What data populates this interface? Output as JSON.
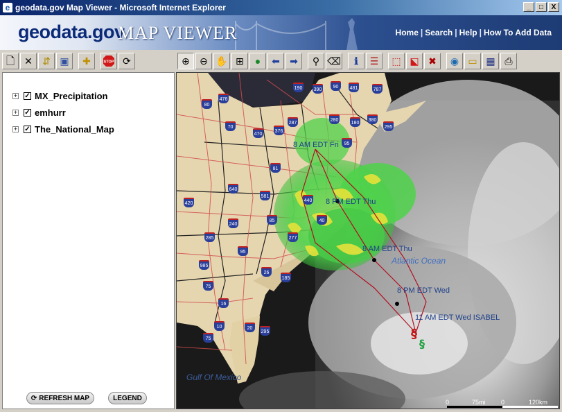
{
  "window": {
    "title": "geodata.gov Map Viewer - Microsoft Internet Explorer",
    "buttons": [
      "_",
      "□",
      "X"
    ]
  },
  "banner": {
    "logo_text": "geodata.gov",
    "app_title": "MAP VIEWER",
    "nav": [
      "Home",
      "Search",
      "Help",
      "How To Add Data"
    ]
  },
  "toolbar_left": [
    {
      "icon": "new-document-icon",
      "glyph": "🗋"
    },
    {
      "icon": "close-x-icon",
      "glyph": "✕"
    },
    {
      "icon": "layer-order-icon",
      "glyph": "⇵"
    },
    {
      "icon": "layer-properties-icon",
      "glyph": "▣"
    },
    {
      "icon": "add-data-icon",
      "glyph": "✚"
    },
    {
      "icon": "stop-icon",
      "glyph": "STOP"
    },
    {
      "icon": "refresh-icon",
      "glyph": "⟳"
    }
  ],
  "toolbar_right": [
    {
      "icon": "zoom-in-icon",
      "glyph": "⊕",
      "active": true
    },
    {
      "icon": "zoom-out-icon",
      "glyph": "⊖"
    },
    {
      "icon": "pan-hand-icon",
      "glyph": "✋"
    },
    {
      "icon": "zoom-extent-icon",
      "glyph": "⊞"
    },
    {
      "icon": "full-extent-globe-icon",
      "glyph": "🌐"
    },
    {
      "icon": "back-arrow-icon",
      "glyph": "⬅"
    },
    {
      "icon": "forward-arrow-icon",
      "glyph": "➡"
    },
    {
      "icon": "find-binoculars-icon",
      "glyph": "⛯"
    },
    {
      "icon": "clear-trash-icon",
      "glyph": "🗑"
    },
    {
      "icon": "info-icon",
      "glyph": "ℹ"
    },
    {
      "icon": "legend-list-icon",
      "glyph": "☰"
    },
    {
      "icon": "select-rectangle-icon",
      "glyph": "⬚"
    },
    {
      "icon": "select-feature-icon",
      "glyph": "⬕"
    },
    {
      "icon": "clear-selection-icon",
      "glyph": "🗑"
    },
    {
      "icon": "print-globe-icon",
      "glyph": "🌍"
    },
    {
      "icon": "open-folder-icon",
      "glyph": "📂"
    },
    {
      "icon": "save-disk-icon",
      "glyph": "💾"
    },
    {
      "icon": "print-icon",
      "glyph": "🖶"
    }
  ],
  "layers": [
    {
      "name": "MX_Precipitation",
      "checked": true
    },
    {
      "name": "emhurr",
      "checked": true
    },
    {
      "name": "The_National_Map",
      "checked": true
    }
  ],
  "panel_buttons": {
    "refresh": "REFRESH MAP",
    "legend": "LEGEND"
  },
  "map_labels": {
    "track": [
      "8 AM EDT Fri",
      "8 PM EDT Thu",
      "8 AM EDT Thu",
      "8 PM EDT Wed",
      "11 AM EDT Wed ISABEL"
    ],
    "atlantic": "Atlantic Ocean",
    "gulf": "Gulf Of Mexico"
  },
  "highway_shields": [
    "190",
    "390",
    "90",
    "481",
    "787",
    "80",
    "476",
    "280",
    "180",
    "380",
    "295",
    "70",
    "470",
    "376",
    "287",
    "95",
    "81",
    "581",
    "440",
    "40",
    "85",
    "277",
    "26",
    "95",
    "185",
    "75",
    "285",
    "985",
    "20",
    "16",
    "75",
    "295",
    "10",
    "640",
    "240",
    "420"
  ],
  "scale": {
    "labels": [
      "0",
      "75mi",
      "0",
      "120km"
    ]
  },
  "colors": {
    "title_bar": "#0a246a",
    "banner_dark": "#1d3b74",
    "precip_green": "#4fd24b",
    "precip_yellow": "#e6e23a",
    "track_red": "#b01020"
  }
}
